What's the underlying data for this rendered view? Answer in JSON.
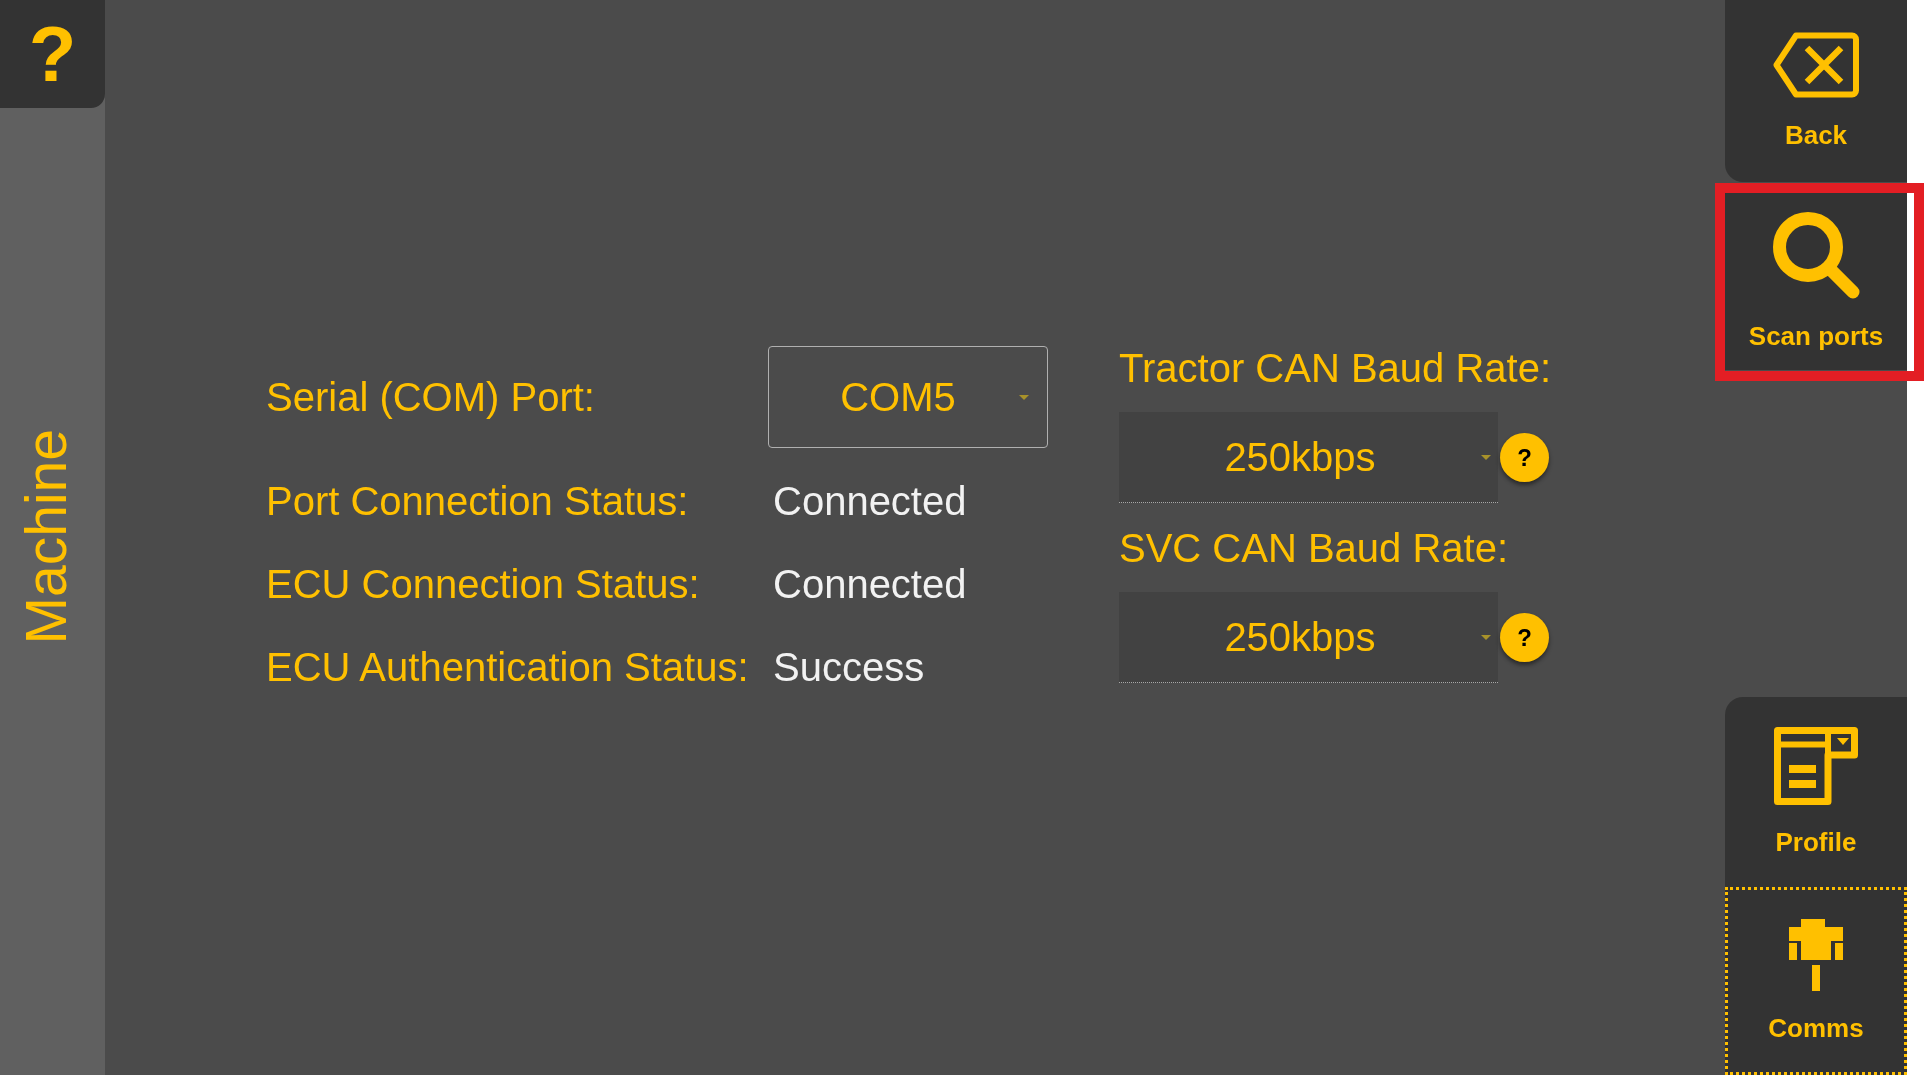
{
  "help_button": {
    "label": "?"
  },
  "sidebar": {
    "title": "Machine"
  },
  "form": {
    "rows": [
      {
        "label": "Serial (COM) Port:",
        "kind": "dropdown",
        "value": "COM5"
      },
      {
        "label": "Port Connection Status:",
        "kind": "text",
        "value": "Connected"
      },
      {
        "label": "ECU Connection Status:",
        "kind": "text",
        "value": "Connected"
      },
      {
        "label": "ECU Authentication Status:",
        "kind": "text",
        "value": "Success"
      }
    ],
    "baud_rates": [
      {
        "label": "Tractor CAN Baud Rate:",
        "value": "250kbps",
        "help": "?"
      },
      {
        "label": "SVC CAN Baud Rate:",
        "value": "250kbps",
        "help": "?"
      }
    ]
  },
  "right_bar": {
    "top_buttons": [
      {
        "label": "Back",
        "selected": false,
        "highlighted": false
      },
      {
        "label": "Scan ports",
        "selected": false,
        "highlighted": true
      }
    ],
    "bottom_buttons": [
      {
        "label": "Profile",
        "selected": false,
        "highlighted": false
      },
      {
        "label": "Comms",
        "selected": true,
        "highlighted": false
      }
    ]
  }
}
